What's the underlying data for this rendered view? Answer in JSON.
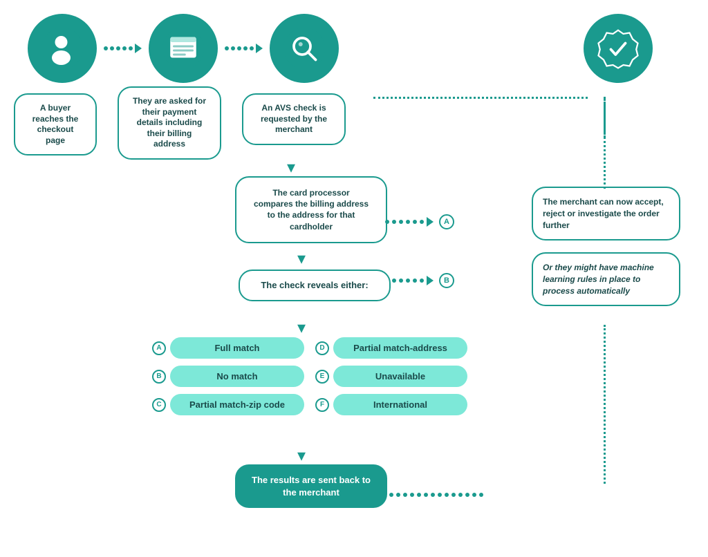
{
  "icons": {
    "buyer": "buyer-icon",
    "payment": "payment-icon",
    "avs": "avs-check-icon",
    "verified": "verified-icon"
  },
  "steps": {
    "step1": "A buyer reaches the checkout page",
    "step2": "They are asked for their payment details including their billing address",
    "step3": "An AVS check is requested by the merchant",
    "step4": "The card processor compares the billing address to the address for that cardholder",
    "step5": "The check reveals either:",
    "step6": "The results are sent back to the merchant"
  },
  "right_boxes": {
    "a": {
      "label": "A",
      "text": "The merchant can now accept, reject or investigate the order further"
    },
    "b": {
      "label": "B",
      "text": "Or they might have machine learning rules in place to process automatically"
    }
  },
  "options": [
    {
      "badge": "A",
      "label": "Full match"
    },
    {
      "badge": "D",
      "label": "Partial match-address"
    },
    {
      "badge": "B",
      "label": "No match"
    },
    {
      "badge": "E",
      "label": "Unavailable"
    },
    {
      "badge": "C",
      "label": "Partial match-zip code"
    },
    {
      "badge": "F",
      "label": "International"
    }
  ],
  "arrows": {
    "down": "▾",
    "dots_arrow": "·····>"
  }
}
